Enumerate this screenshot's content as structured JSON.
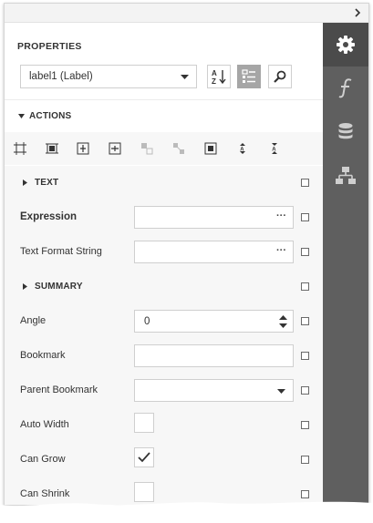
{
  "header": {
    "collapse_icon": "chevron-right-icon"
  },
  "properties": {
    "title": "PROPERTIES",
    "selected_component": "label1 (Label)",
    "sort_icon": "sort-alphabetical-icon",
    "categories_icon": "categories-icon",
    "search_icon": "search-icon"
  },
  "actions": {
    "title": "ACTIONS",
    "icons": [
      "fit-bounds-to-container-icon",
      "fit-to-container-icon",
      "center-horizontally-icon",
      "center-vertically-icon",
      "align-to-grid-icon",
      "size-to-grid-icon",
      "center-in-container-icon",
      "increase-spacing-icon",
      "decrease-spacing-icon"
    ]
  },
  "sections": {
    "text": "TEXT",
    "summary": "SUMMARY"
  },
  "rows": {
    "expression": {
      "label": "Expression",
      "value": "",
      "button": "···"
    },
    "text_format_string": {
      "label": "Text Format String",
      "value": "",
      "button": "···"
    },
    "angle": {
      "label": "Angle",
      "value": "0"
    },
    "bookmark": {
      "label": "Bookmark",
      "value": ""
    },
    "parent_bookmark": {
      "label": "Parent Bookmark",
      "value": ""
    },
    "auto_width": {
      "label": "Auto Width",
      "checked": false
    },
    "can_grow": {
      "label": "Can Grow",
      "checked": true
    },
    "can_shrink": {
      "label": "Can Shrink",
      "checked": false
    }
  },
  "sidebar": {
    "tabs": [
      {
        "icon": "gear-icon",
        "active": true
      },
      {
        "icon": "function-icon",
        "active": false
      },
      {
        "icon": "database-icon",
        "active": false
      },
      {
        "icon": "hierarchy-icon",
        "active": false
      }
    ]
  },
  "colors": {
    "sidebar_bg": "#5f5f5f",
    "sidebar_active": "#4b4b4b",
    "toggle_active": "#a6a6a6"
  }
}
